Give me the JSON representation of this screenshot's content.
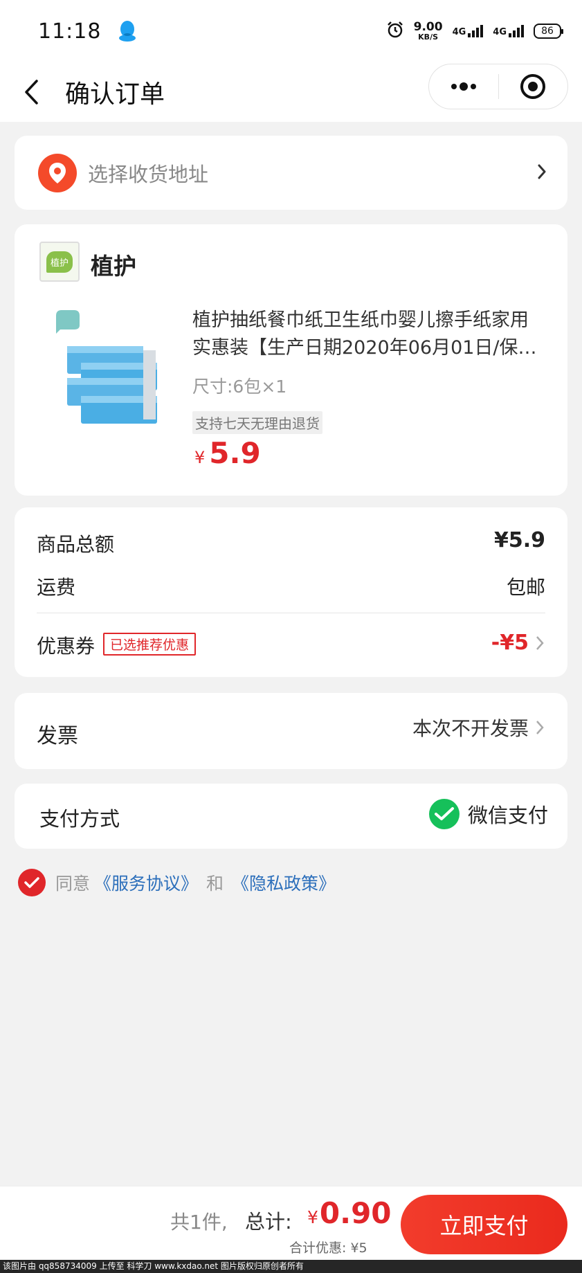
{
  "status_bar": {
    "time": "11:18",
    "net_speed_value": "9.00",
    "net_speed_unit": "KB/S",
    "signal1": "4G",
    "signal2": "4G",
    "battery": "86"
  },
  "nav": {
    "title": "确认订单"
  },
  "address": {
    "placeholder": "选择收货地址"
  },
  "shop": {
    "logo_text": "植护",
    "name": "植护"
  },
  "product": {
    "title_line1": "植护抽纸餐巾纸卫生纸巾婴儿擦手纸家用",
    "title_line2": "实惠装【生产日期2020年06月01日/保…",
    "spec": "尺寸:6包×1",
    "return_tag": "支持七天无理由退货",
    "currency": "¥",
    "price": "5.9"
  },
  "summary": {
    "total_label": "商品总额",
    "total_value": "¥5.9",
    "shipping_label": "运费",
    "shipping_value": "包邮",
    "coupon_label": "优惠券",
    "coupon_tag": "已选推荐优惠",
    "coupon_value": "-¥5"
  },
  "invoice": {
    "label": "发票",
    "value": "本次不开发票"
  },
  "payment": {
    "label": "支付方式",
    "method": "微信支付"
  },
  "agreement": {
    "prefix": "同意",
    "service_link": "《服务协议》",
    "and": "和",
    "privacy_link": "《隐私政策》"
  },
  "bottom_bar": {
    "count_text": "共1件,",
    "total_label": "总计:",
    "currency": "¥",
    "total_value": "0.90",
    "discount_text": "合计优惠: ¥5",
    "pay_button": "立即支付"
  },
  "watermark": "该图片由 qq858734009 上传至 科学刀 www.kxdao.net 图片版权归原创者所有",
  "colors": {
    "accent_red": "#e0262a",
    "link_blue": "#2c6fbb",
    "wechat_green": "#16c05a",
    "location_orange": "#f44a2a"
  }
}
